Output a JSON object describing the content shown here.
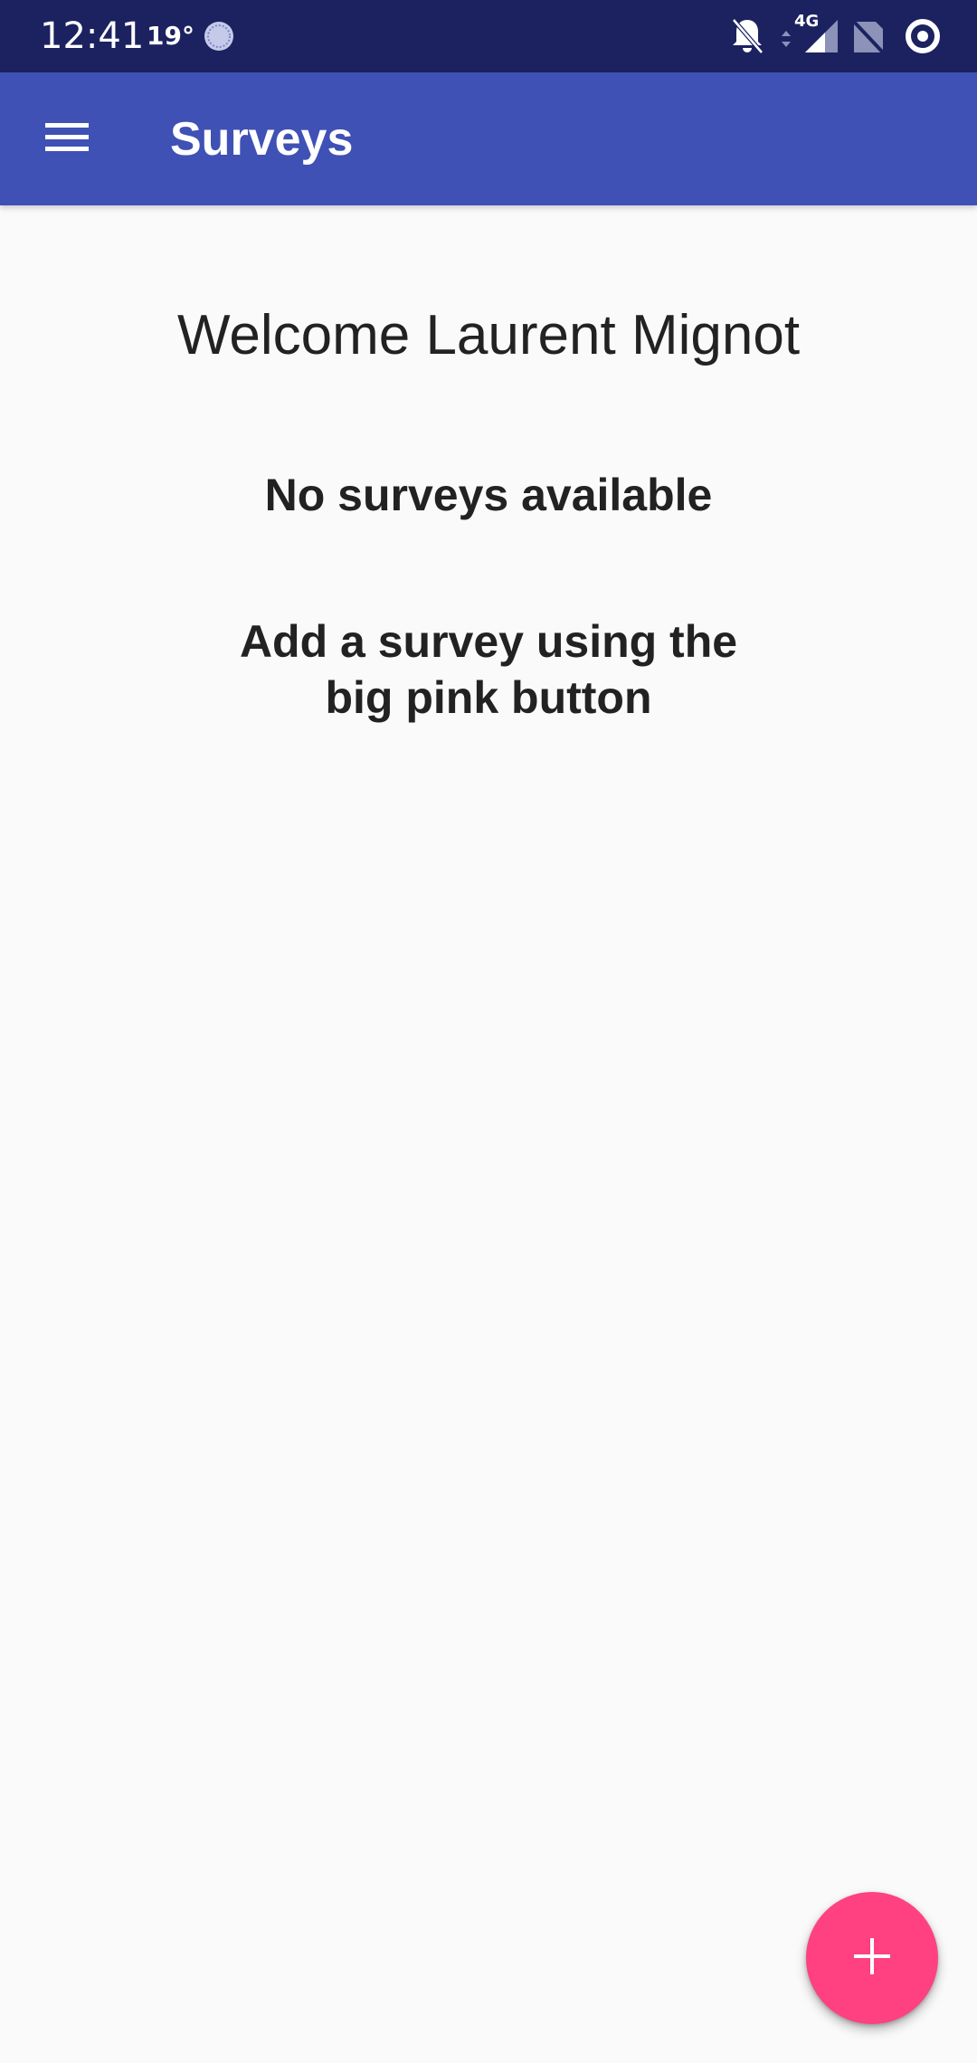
{
  "status_bar": {
    "time": "12:41",
    "temperature": "19°",
    "network_type": "4G",
    "background_color": "#1c2260"
  },
  "app_bar": {
    "title": "Surveys",
    "menu_icon": "hamburger-menu-icon",
    "background_color": "#3f51b5"
  },
  "main": {
    "welcome_text": "Welcome Laurent Mignot",
    "empty_title": "No surveys available",
    "empty_hint": "Add a survey using the big pink button"
  },
  "fab": {
    "icon": "plus-icon",
    "color": "#ff4081"
  }
}
